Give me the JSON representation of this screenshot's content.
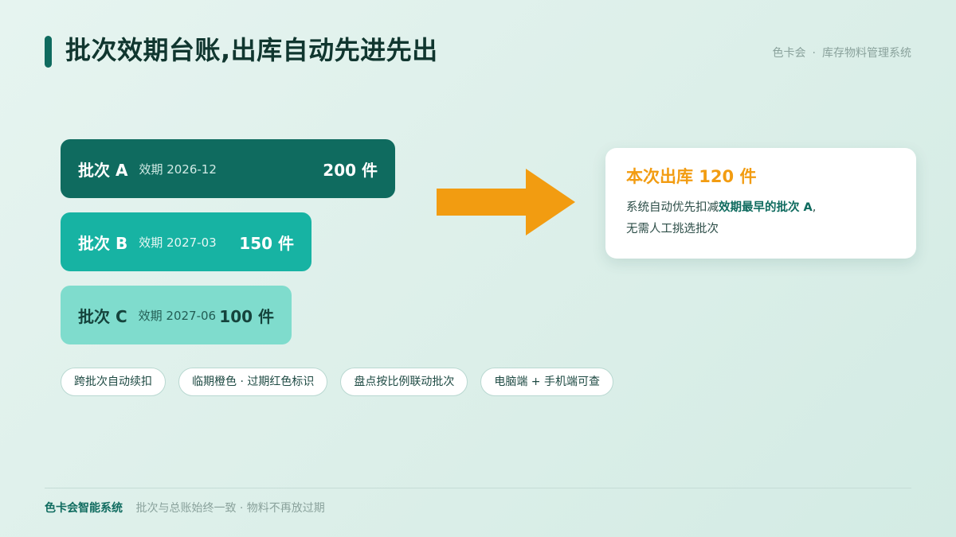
{
  "header": {
    "title": "批次效期台账,出库自动先进先出",
    "brand_name": "色卡会",
    "separator": "·",
    "system_name": "库存物料管理系统"
  },
  "batches": [
    {
      "name": "批次 A",
      "expiry": "效期 2026-12",
      "qty": "200 件"
    },
    {
      "name": "批次 B",
      "expiry": "效期 2027-03",
      "qty": "150 件"
    },
    {
      "name": "批次 C",
      "expiry": "效期 2027-06",
      "qty": "100 件"
    }
  ],
  "tags": [
    "跨批次自动续扣",
    "临期橙色 · 过期红色标识",
    "盘点按比例联动批次",
    "电脑端 + 手机端可查"
  ],
  "result": {
    "title": "本次出库 120 件",
    "line1_prefix": "系统自动优先扣减",
    "line1_highlight": "效期最早的批次 A",
    "line1_suffix": ",",
    "line2": "无需人工挑选批次"
  },
  "footer": {
    "brand": "色卡会智能系统",
    "slogan": "批次与总账始终一致 · 物料不再放过期"
  },
  "colors": {
    "primary_dark": "#0f6b5f",
    "primary_mid": "#17b3a3",
    "primary_light": "#7fdccd",
    "accent_orange": "#f29c11"
  },
  "icons": {
    "flow_arrow": "right-arrow-icon"
  }
}
